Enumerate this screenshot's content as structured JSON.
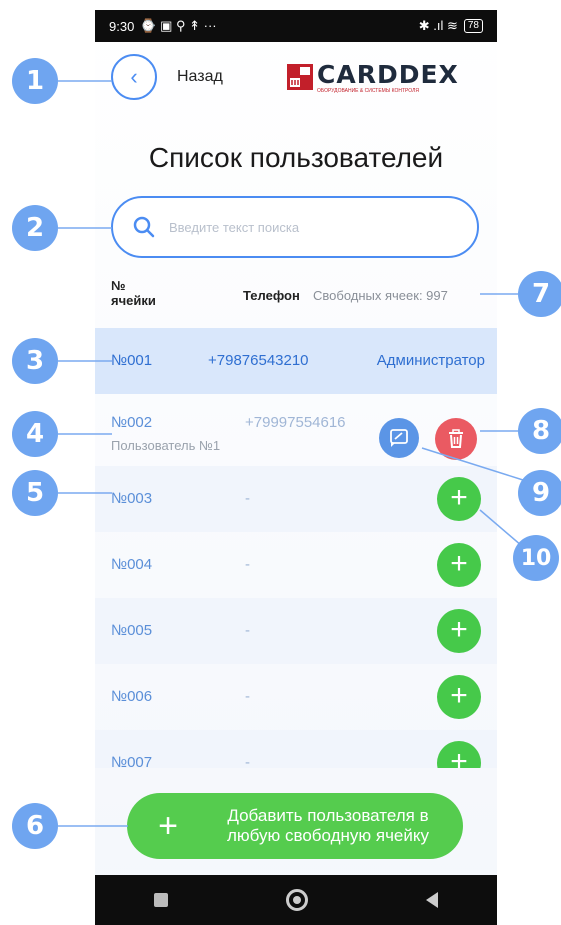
{
  "status_bar": {
    "time": "9:30",
    "extras": "⌚ ▣ ⚲ ↟ ···",
    "signal": "✱ .ıl ≋",
    "battery": "78"
  },
  "header": {
    "back_label": "Назад",
    "logo_text": "CARDDEX",
    "logo_subtitle": "ОБОРУДОВАНИЕ & СИСТЕМЫ КОНТРОЛЯ"
  },
  "page_title": "Список пользователей",
  "search": {
    "placeholder": "Введите текст поиска",
    "value": ""
  },
  "columns": {
    "cell": "№\nячейки",
    "phone": "Телефон",
    "free_cells": "Свободных ячеек: 997"
  },
  "rows": [
    {
      "cell": "№001",
      "phone": "+79876543210",
      "role": "Администратор"
    },
    {
      "cell": "№002",
      "phone": "+79997554616",
      "name": "Пользователь №1"
    },
    {
      "cell": "№003",
      "phone": "-"
    },
    {
      "cell": "№004",
      "phone": "-"
    },
    {
      "cell": "№005",
      "phone": "-"
    },
    {
      "cell": "№006",
      "phone": "-"
    },
    {
      "cell": "№007",
      "phone": "-"
    }
  ],
  "bottom_button": {
    "plus": "+",
    "label": "Добавить пользователя в любую свободную ячейку"
  },
  "callouts": [
    "1",
    "2",
    "3",
    "4",
    "5",
    "6",
    "7",
    "8",
    "9",
    "10"
  ],
  "colors": {
    "accent": "#4b8cf2",
    "add_green": "#46c94a",
    "delete_red": "#ea5a62",
    "callout_blue": "#6fa5f0"
  }
}
